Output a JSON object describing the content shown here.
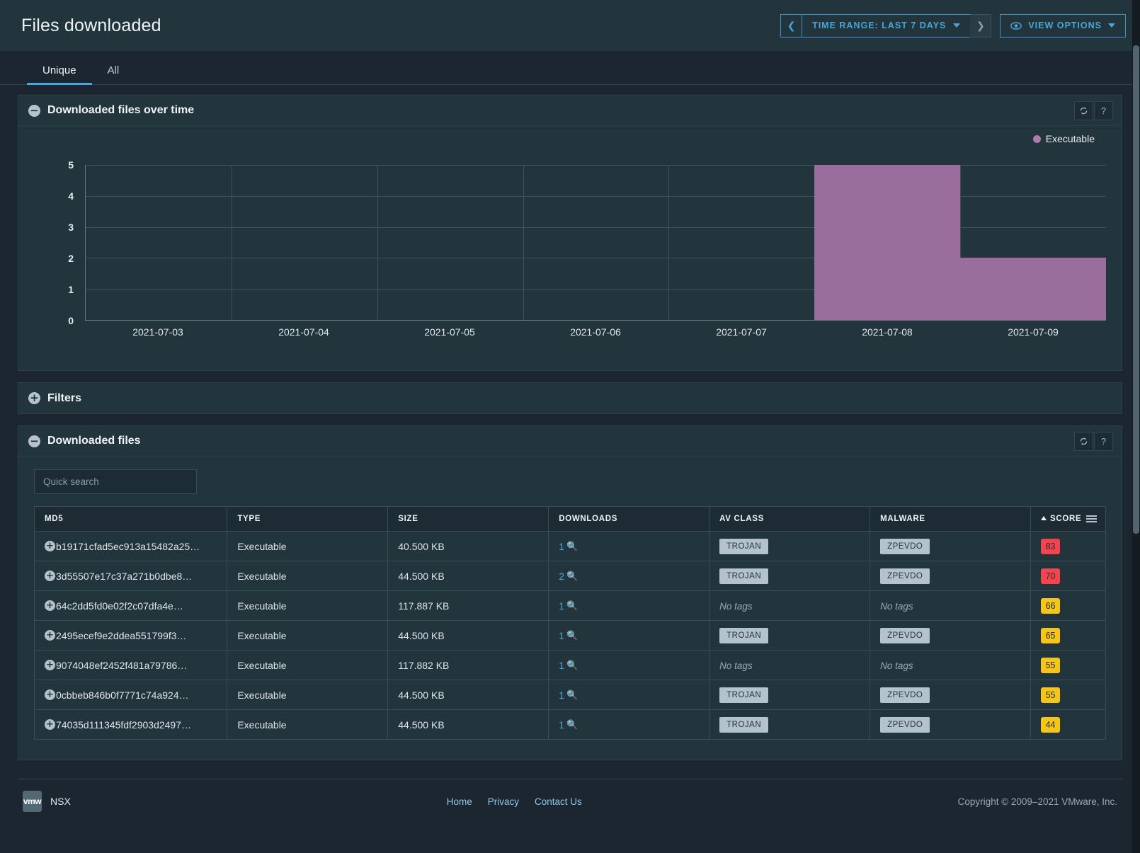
{
  "header": {
    "title": "Files downloaded",
    "time_range": {
      "prev_icon": "chevron-left-icon",
      "label": "TIME RANGE: LAST 7 DAYS",
      "next_icon": "chevron-right-icon"
    },
    "view_options": {
      "icon": "eye-icon",
      "label": "VIEW OPTIONS"
    }
  },
  "tabs": [
    {
      "label": "Unique",
      "active": true
    },
    {
      "label": "All",
      "active": false
    }
  ],
  "chart_panel": {
    "title": "Downloaded files over time",
    "toggle": "minus-circle-icon",
    "refresh_icon": "refresh-icon",
    "help_icon": "help-icon",
    "refresh_label": "↻",
    "help_label": "?"
  },
  "filters_panel": {
    "title": "Filters",
    "toggle": "plus-circle-icon"
  },
  "table_panel": {
    "title": "Downloaded files",
    "toggle": "minus-circle-icon",
    "refresh_label": "↻",
    "help_label": "?",
    "search_placeholder": "Quick search",
    "search_value": "",
    "columns": [
      "MD5",
      "TYPE",
      "SIZE",
      "DOWNLOADS",
      "AV CLASS",
      "MALWARE",
      "SCORE"
    ],
    "sorted_column": "SCORE",
    "sort_direction": "asc",
    "menu_icon": "hamburger-icon",
    "expand_icon": "plus-circle-icon",
    "downloads_icon": "magnifier-icon",
    "no_tags_text": "No tags",
    "rows": [
      {
        "md5": "b19171cfad5ec913a15482a25…",
        "type": "Executable",
        "size": "40.500 KB",
        "downloads": "1",
        "av_class": "TROJAN",
        "malware": "ZPEVDO",
        "score": "83",
        "score_color": "#f4454f"
      },
      {
        "md5": "3d55507e17c37a271b0dbe8…",
        "type": "Executable",
        "size": "44.500 KB",
        "downloads": "2",
        "av_class": "TROJAN",
        "malware": "ZPEVDO",
        "score": "70",
        "score_color": "#f4454f"
      },
      {
        "md5": "64c2dd5fd0e02f2c07dfa4e…",
        "type": "Executable",
        "size": "117.887 KB",
        "downloads": "1",
        "av_class": "",
        "malware": "",
        "score": "66",
        "score_color": "#f5c518"
      },
      {
        "md5": "2495ecef9e2ddea551799f3…",
        "type": "Executable",
        "size": "44.500 KB",
        "downloads": "1",
        "av_class": "TROJAN",
        "malware": "ZPEVDO",
        "score": "65",
        "score_color": "#f5c518"
      },
      {
        "md5": "9074048ef2452f481a79786…",
        "type": "Executable",
        "size": "117.882 KB",
        "downloads": "1",
        "av_class": "",
        "malware": "",
        "score": "55",
        "score_color": "#f5c518"
      },
      {
        "md5": "0cbbeb846b0f7771c74a924…",
        "type": "Executable",
        "size": "44.500 KB",
        "downloads": "1",
        "av_class": "TROJAN",
        "malware": "ZPEVDO",
        "score": "55",
        "score_color": "#f5c518"
      },
      {
        "md5": "74035d111345fdf2903d2497…",
        "type": "Executable",
        "size": "44.500 KB",
        "downloads": "1",
        "av_class": "TROJAN",
        "malware": "ZPEVDO",
        "score": "44",
        "score_color": "#f5c518"
      }
    ]
  },
  "footer": {
    "logo_text": "vmw",
    "product": "NSX",
    "links": [
      "Home",
      "Privacy",
      "Contact Us"
    ],
    "copyright": "Copyright © 2009–2021 VMware, Inc."
  },
  "chart_data": {
    "type": "bar",
    "title": "Downloaded files over time",
    "categories": [
      "2021-07-03",
      "2021-07-04",
      "2021-07-05",
      "2021-07-06",
      "2021-07-07",
      "2021-07-08",
      "2021-07-09"
    ],
    "series": [
      {
        "name": "Executable",
        "color": "#9a6e9c",
        "values": [
          0,
          0,
          0,
          0,
          0,
          5,
          2
        ]
      }
    ],
    "xlabel": "",
    "ylabel": "",
    "ylim": [
      0,
      5
    ],
    "yticks": [
      0,
      1,
      2,
      3,
      4,
      5
    ],
    "grid": true,
    "legend": "top-right"
  }
}
